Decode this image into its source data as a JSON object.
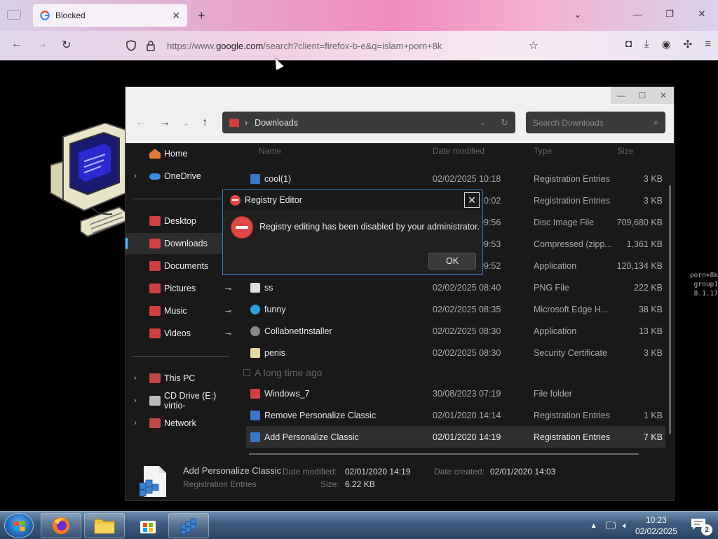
{
  "browser": {
    "tab_title": "Blocked",
    "new_tab": "+",
    "url_prefix": "https://www.",
    "url_domain": "google.com",
    "url_rest": "/search?client=firefox-b-e&q=islam+porn+8k"
  },
  "explorer": {
    "address_location": "Downloads",
    "search_placeholder": "Search Downloads",
    "nav": {
      "home": "Home",
      "onedrive": "OneDrive",
      "desktop": "Desktop",
      "downloads": "Downloads",
      "documents": "Documents",
      "pictures": "Pictures",
      "music": "Music",
      "videos": "Videos",
      "this_pc": "This PC",
      "cd_drive": "CD Drive (E:) virtio-",
      "network": "Network"
    },
    "columns": {
      "name": "Name",
      "date": "Date modified",
      "type": "Type",
      "size": "Size"
    },
    "files": [
      {
        "name": "cool(1)",
        "date": "02/02/2025 10:18",
        "type": "Registration Entries",
        "size": "3 KB"
      },
      {
        "name": "",
        "date": "02/02/2025 10:02",
        "type": "Registration Entries",
        "size": "3 KB"
      },
      {
        "name": "",
        "date": "02/02/2025 09:56",
        "type": "Disc Image File",
        "size": "709,680 KB"
      },
      {
        "name": "",
        "date": "02/02/2025 09:53",
        "type": "Compressed (zipp...",
        "size": "1,361 KB"
      },
      {
        "name": "",
        "date": "02/02/2025 09:52",
        "type": "Application",
        "size": "120,134 KB"
      },
      {
        "name": "ss",
        "date": "02/02/2025 08:40",
        "type": "PNG File",
        "size": "222 KB"
      },
      {
        "name": "funny",
        "date": "02/02/2025 08:35",
        "type": "Microsoft Edge H...",
        "size": "38 KB"
      },
      {
        "name": "CollabnetInstaller",
        "date": "02/02/2025 08:30",
        "type": "Application",
        "size": "13 KB"
      },
      {
        "name": "penis",
        "date": "02/02/2025 08:30",
        "type": "Security Certificate",
        "size": "3 KB"
      }
    ],
    "group_label": "A long time ago",
    "old_files": [
      {
        "name": "Windows_7",
        "date": "30/08/2023 07:19",
        "type": "File folder",
        "size": ""
      },
      {
        "name": "Remove Personalize Classic",
        "date": "02/01/2020 14:14",
        "type": "Registration Entries",
        "size": "1 KB"
      },
      {
        "name": "Add Personalize Classic",
        "date": "02/01/2020 14:19",
        "type": "Registration Entries",
        "size": "7 KB"
      }
    ],
    "details": {
      "name": "Add Personalize Classic",
      "kind": "Registration Entries",
      "modified_label": "Date modified:",
      "modified_value": "02/01/2020 14:19",
      "created_label": "Date created:",
      "created_value": "02/01/2020 14:03",
      "size_label": "Size:",
      "size_value": "6.22 KB"
    }
  },
  "dialog": {
    "title": "Registry Editor",
    "message": "Registry editing has been disabled by your administrator.",
    "ok_label": "OK"
  },
  "terminal_fragment": {
    "line1": "porn+8k",
    "line2": "group1",
    "line3": "8.1.17"
  },
  "taskbar": {
    "time": "10:23",
    "date": "02/02/2025",
    "notification_count": "2"
  },
  "colors": {
    "dialog_border": "#3a79c4",
    "error_red": "#e04848",
    "selection_accent": "#4cc2ff"
  }
}
